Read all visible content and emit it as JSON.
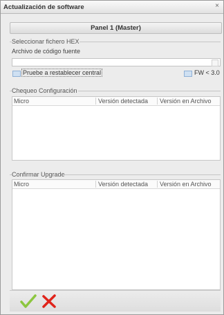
{
  "window": {
    "title": "Actualización de software",
    "close_glyph": "×"
  },
  "panel": {
    "header": "Panel 1 (Master)"
  },
  "hex_section": {
    "legend": "Seleccionar fichero HEX",
    "source_label": "Archivo de código fuente",
    "source_value": "",
    "reset_check_label": "Pruebe a restablecer central",
    "fw_check_label": "FW < 3.0"
  },
  "config_section": {
    "legend": "Chequeo Configuración",
    "columns": [
      "Micro",
      "Versión detectada",
      "Versión en Archivo"
    ],
    "rows": []
  },
  "upgrade_section": {
    "legend": "Confirmar Upgrade",
    "columns": [
      "Micro",
      "Versión detectada",
      "Versión en Archivo"
    ],
    "rows": []
  },
  "footer": {
    "confirm_icon": "checkmark-icon",
    "cancel_icon": "cross-icon",
    "confirm_color": "#8cc63f",
    "cancel_color": "#e0241b"
  }
}
